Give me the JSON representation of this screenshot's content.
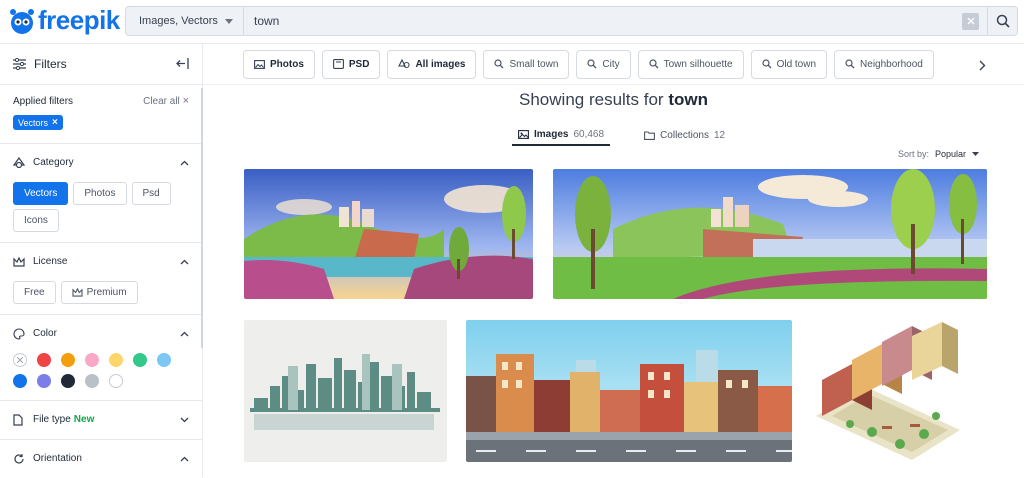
{
  "header": {
    "brand": "freepik",
    "search_type": "Images, Vectors",
    "search_value": "town"
  },
  "sidebar": {
    "title": "Filters",
    "applied_label": "Applied filters",
    "clear_all": "Clear all",
    "applied_chip": "Vectors",
    "category": {
      "title": "Category",
      "options": [
        "Vectors",
        "Photos",
        "Psd",
        "Icons"
      ],
      "selected": "Vectors"
    },
    "license": {
      "title": "License",
      "options": [
        "Free",
        "Premium"
      ]
    },
    "color": {
      "title": "Color",
      "swatches": [
        "none",
        "#ef4444",
        "#f59e0b",
        "#f9a8c8",
        "#fcd56b",
        "#34c98a",
        "#7cc7f5",
        "#1273eb",
        "#7b7ee8",
        "#1f2937",
        "#b9c0c8",
        "#ffffff"
      ]
    },
    "file_type": {
      "title": "File type",
      "badge": "New"
    },
    "orientation": {
      "title": "Orientation"
    }
  },
  "tags": [
    "Photos",
    "PSD",
    "All images",
    "Small town",
    "City",
    "Town silhouette",
    "Old town",
    "Neighborhood"
  ],
  "results": {
    "prefix": "Showing results for",
    "query": "town",
    "tabs": [
      {
        "label": "Images",
        "count": "60,468"
      },
      {
        "label": "Collections",
        "count": "12"
      }
    ],
    "sort_label": "Sort by:",
    "sort_value": "Popular"
  },
  "colors": {
    "accent": "#1273eb"
  }
}
